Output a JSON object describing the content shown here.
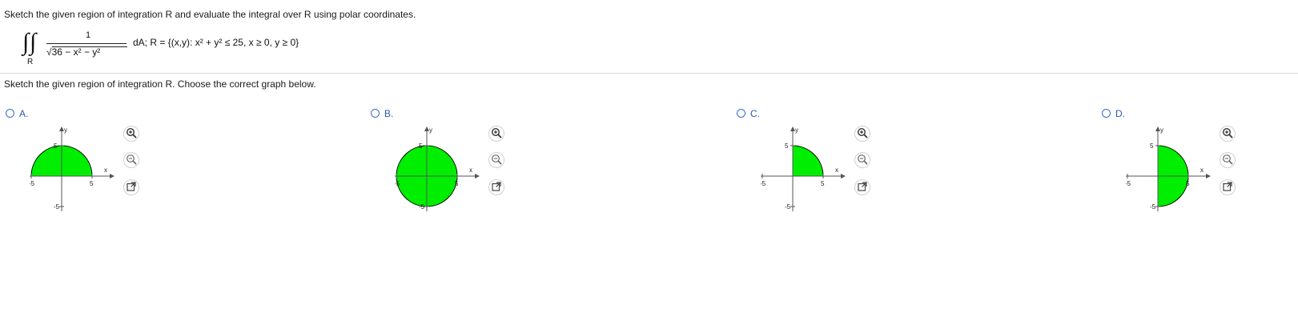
{
  "instructions": {
    "line1": "Sketch the given region of integration R and evaluate the integral over R using polar coordinates.",
    "line2": "Sketch the given region of integration R. Choose the correct graph below."
  },
  "problem": {
    "integral_symbol": "∫",
    "region_subscript": "R",
    "numerator": "1",
    "denominator_html": "√36 − x² − y²",
    "rest_text": "dA; R = {(x,y): x² + y² ≤ 25, x ≥ 0, y ≥ 0}"
  },
  "options": [
    {
      "label": "A.",
      "region": "upper-half"
    },
    {
      "label": "B.",
      "region": "full-circle"
    },
    {
      "label": "C.",
      "region": "first-quadrant"
    },
    {
      "label": "D.",
      "region": "right-half"
    }
  ],
  "graph": {
    "x_axis_label": "x",
    "y_axis_label": "y",
    "tick_pos": "5",
    "tick_neg": "-5",
    "fill_color": "#00ee00",
    "radius": 5
  },
  "tools": [
    "zoom-in-icon",
    "zoom-out-icon",
    "open-external-icon"
  ],
  "colors": {
    "accent": "#2a57b5"
  }
}
